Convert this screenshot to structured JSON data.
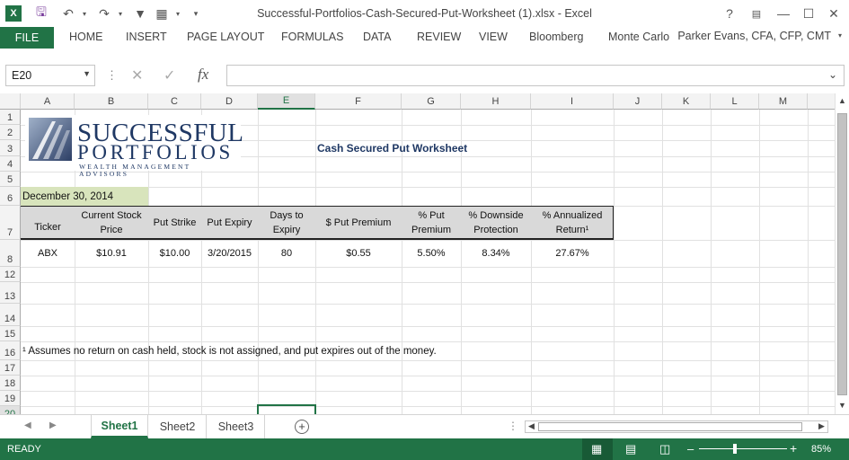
{
  "window": {
    "title": "Successful-Portfolios-Cash-Secured-Put-Worksheet (1).xlsx - Excel"
  },
  "ribbon": {
    "file": "FILE",
    "tabs": [
      "HOME",
      "INSERT",
      "PAGE LAYOUT",
      "FORMULAS",
      "DATA",
      "REVIEW",
      "VIEW",
      "Bloomberg",
      "Monte Carlo"
    ],
    "user": "Parker Evans, CFA, CFP, CMT"
  },
  "formula_bar": {
    "name_box": "E20",
    "fx": "fx",
    "value": ""
  },
  "columns": [
    "A",
    "B",
    "C",
    "D",
    "E",
    "F",
    "G",
    "H",
    "I",
    "J",
    "K",
    "L",
    "M"
  ],
  "rows": [
    "1",
    "2",
    "3",
    "4",
    "5",
    "6",
    "7",
    "8",
    "12",
    "13",
    "14",
    "15",
    "16",
    "17",
    "18",
    "19",
    "20"
  ],
  "logo": {
    "line1": "SUCCESSFUL",
    "line2": "PORTFOLIOS",
    "line3": "WEALTH MANAGEMENT ADVISORS"
  },
  "sheet": {
    "title": "Cash Secured Put Worksheet",
    "date": "December 30, 2014",
    "headers": [
      "Ticker",
      "Current Stock Price",
      "Put Strike",
      "Put Expiry",
      "Days to Expiry",
      "$ Put Premium",
      "% Put Premium",
      "% Downside Protection",
      "% Annualized Return¹"
    ],
    "row": [
      "ABX",
      "$10.91",
      "$10.00",
      "3/20/2015",
      "80",
      "$0.55",
      "5.50%",
      "8.34%",
      "27.67%"
    ],
    "footnote": "¹ Assumes no return on cash held, stock is not assigned, and put expires out of the money."
  },
  "sheets": {
    "tabs": [
      "Sheet1",
      "Sheet2",
      "Sheet3"
    ],
    "active": "Sheet1"
  },
  "status": {
    "ready": "READY",
    "zoom": "85%"
  },
  "colors": {
    "excel_green": "#217346",
    "date_fill": "#d8e4bc",
    "header_fill": "#d9d9d9",
    "title_blue": "#1f3864"
  }
}
